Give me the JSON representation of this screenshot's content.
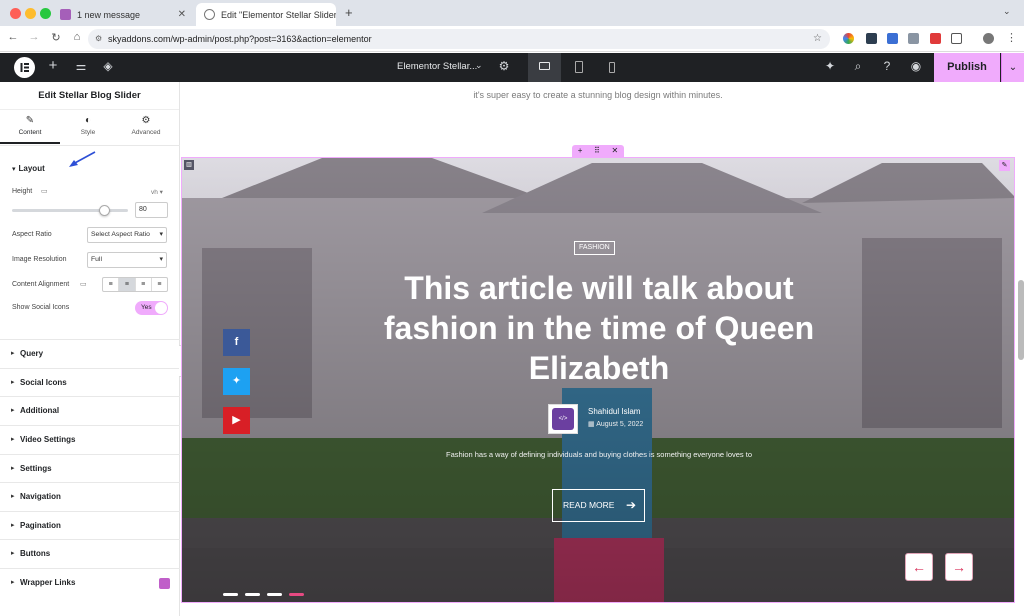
{
  "browser": {
    "tabs": [
      {
        "label": "1 new message"
      },
      {
        "label": "Edit \"Elementor Stellar Slider"
      }
    ],
    "url": "skyaddons.com/wp-admin/post.php?post=3163&action=elementor"
  },
  "topbar": {
    "doc_title": "Elementor Stellar...",
    "publish_label": "Publish"
  },
  "panel": {
    "title": "Edit Stellar Blog Slider",
    "tabs": [
      {
        "label": "Content",
        "icon": "pencil-icon"
      },
      {
        "label": "Style",
        "icon": "half-circle-icon"
      },
      {
        "label": "Advanced",
        "icon": "gear-icon"
      }
    ],
    "layout": {
      "heading": "Layout",
      "height_label": "Height",
      "height_unit": "vh",
      "height_value": "80",
      "height_slider_fraction": 0.8,
      "aspect_ratio_label": "Aspect Ratio",
      "aspect_ratio_value": "Select Aspect Ratio",
      "image_resolution_label": "Image Resolution",
      "image_resolution_value": "Full",
      "content_alignment_label": "Content Alignment",
      "content_alignment_selected": "center",
      "show_social_label": "Show Social Icons",
      "show_social_value": "Yes"
    },
    "sections": [
      "Query",
      "Social Icons",
      "Additional",
      "Video Settings",
      "Settings",
      "Navigation",
      "Pagination",
      "Buttons",
      "Wrapper Links"
    ]
  },
  "canvas": {
    "intro_text": "it's super easy to create a stunning blog design within minutes.",
    "category": "FASHION",
    "headline": "This article will talk about fashion in the time of Queen Elizabeth",
    "author_name": "Shahidul Islam",
    "date": "August 5, 2022",
    "excerpt": "Fashion has a way of defining individuals and buying clothes is something everyone loves to",
    "read_more": "READ MORE",
    "pagination_count": 4,
    "pagination_active": 4,
    "social": [
      "facebook-icon",
      "twitter-icon",
      "youtube-icon"
    ]
  },
  "colors": {
    "accent": "#f0abfc",
    "facebook": "#3b5998",
    "twitter": "#1da1f2",
    "youtube": "#d81f26",
    "arrow": "#d9325b"
  }
}
